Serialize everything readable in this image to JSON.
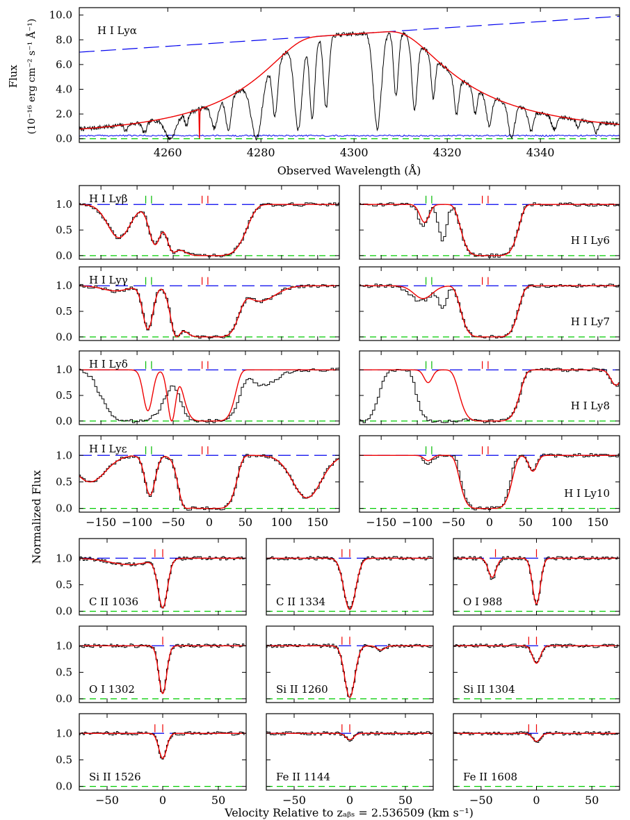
{
  "colors": {
    "data": "#000000",
    "model": "#ee0000",
    "continuum": "#0000ee",
    "error": "#0000ee",
    "zero": "#00cc00",
    "mark_green": "#00bb00",
    "mark_red": "#ee0000"
  },
  "labels": {
    "top_ylabel_1": "Flux",
    "top_ylabel_2": "(10⁻¹⁶ erg cm⁻² s⁻¹ Å⁻¹)",
    "top_xlabel": "Observed Wavelength (Å)",
    "norm_ylabel": "Normalized Flux",
    "bottom_xlabel": "Velocity Relative to zₐᵦₛ = 2.536509 (km s⁻¹)"
  },
  "chart_data": [
    {
      "type": "line",
      "id": "lya",
      "title": "H I Lyα",
      "xlabel": "Observed Wavelength (Å)",
      "ylabel": "Flux (10⁻¹⁶ erg cm⁻² s⁻¹ Å⁻¹)",
      "xlim": [
        4241,
        4357
      ],
      "ylim": [
        -0.3,
        10.6
      ],
      "xticks": [
        4260,
        4280,
        4300,
        4320,
        4340
      ],
      "yticks": [
        0.0,
        2.0,
        4.0,
        6.0,
        8.0,
        10.0
      ],
      "ytick_labels": [
        "0.0",
        "2.0",
        "4.0",
        "6.0",
        "8.0",
        "10.0"
      ],
      "continuum": {
        "x": [
          4241,
          4357
        ],
        "y": [
          7.0,
          9.9
        ]
      },
      "model": {
        "center": 4299.7,
        "width": 9.5,
        "metal_line": 4266.8
      },
      "absorbers": [
        [
          4251,
          0.45,
          0.5
        ],
        [
          4255,
          0.65,
          0.7
        ],
        [
          4260.5,
          1.0,
          1.6
        ],
        [
          4264,
          0.5,
          0.5
        ],
        [
          4270,
          0.7,
          1.0
        ],
        [
          4273,
          0.8,
          0.8
        ],
        [
          4279,
          1.0,
          1.6
        ],
        [
          4283,
          0.7,
          0.8
        ],
        [
          4288,
          0.9,
          1.2
        ],
        [
          4291,
          0.8,
          0.8
        ],
        [
          4294,
          0.7,
          0.8
        ],
        [
          4305,
          0.9,
          1.2
        ],
        [
          4309,
          0.6,
          0.7
        ],
        [
          4313,
          0.7,
          0.8
        ],
        [
          4317,
          0.5,
          0.6
        ],
        [
          4322,
          0.6,
          0.7
        ],
        [
          4326,
          0.5,
          0.6
        ],
        [
          4329,
          0.7,
          0.8
        ],
        [
          4333.8,
          1.0,
          0.9
        ],
        [
          4338,
          0.7,
          0.8
        ],
        [
          4343,
          0.6,
          0.8
        ],
        [
          4348,
          0.4,
          0.5
        ],
        [
          4352,
          0.6,
          0.6
        ]
      ],
      "series": [
        {
          "name": "data"
        },
        {
          "name": "model"
        },
        {
          "name": "continuum"
        },
        {
          "name": "error"
        }
      ]
    },
    {
      "type": "line",
      "id": "lyb",
      "label": "H I Lyβ",
      "label_pos": "top-left",
      "xlim": [
        -180,
        180
      ],
      "ylim": [
        -0.07,
        1.37
      ],
      "yticks": [
        0.0,
        0.5,
        1.0
      ],
      "ytick_labels": [
        "0.0",
        "0.5",
        "1.0"
      ],
      "xticks": [
        -150,
        -100,
        -50,
        0,
        50,
        100,
        150
      ],
      "green_marks": [
        -88,
        -80
      ],
      "red_marks": [
        -10,
        -2
      ],
      "components": [
        [
          -125,
          0.65,
          22
        ],
        [
          -75,
          0.78,
          12
        ],
        [
          -50,
          0.85,
          12
        ],
        [
          0,
          1.0,
          55,
          5
        ]
      ],
      "model_components": [
        [
          -125,
          0.65,
          22
        ],
        [
          -75,
          0.78,
          12
        ],
        [
          -50,
          0.85,
          12
        ],
        [
          0,
          1.0,
          55,
          5
        ]
      ],
      "extra_model_drop": {
        "from": 45,
        "to": 175
      }
    },
    {
      "type": "line",
      "id": "ly6",
      "label": "H I Ly6",
      "label_pos": "bottom-right",
      "xlim": [
        -180,
        180
      ],
      "ylim": [
        -0.07,
        1.37
      ],
      "yticks": [
        0.0,
        0.5,
        1.0
      ],
      "ytick_labels": [
        "0.0",
        "0.5",
        "1.0"
      ],
      "xticks": [
        -150,
        -100,
        -50,
        0,
        50,
        100,
        150
      ],
      "green_marks": [
        -88,
        -80
      ],
      "red_marks": [
        -10,
        -2
      ],
      "components": [
        [
          -92,
          0.4,
          9
        ],
        [
          0,
          1.0,
          42,
          6
        ],
        [
          -65,
          0.7,
          8
        ]
      ],
      "model_components": [
        [
          -90,
          0.35,
          9
        ],
        [
          0,
          1.0,
          42,
          6
        ]
      ]
    },
    {
      "type": "line",
      "id": "lyg",
      "label": "H I Lyγ",
      "label_pos": "top-left",
      "xlim": [
        -180,
        180
      ],
      "ylim": [
        -0.07,
        1.37
      ],
      "yticks": [
        0.0,
        0.5,
        1.0
      ],
      "ytick_labels": [
        "0.0",
        "0.5",
        "1.0"
      ],
      "xticks": [
        -150,
        -100,
        -50,
        0,
        50,
        100,
        150
      ],
      "green_marks": [
        -88,
        -80
      ],
      "red_marks": [
        -10,
        -2
      ],
      "components": [
        [
          -130,
          0.1,
          25
        ],
        [
          -85,
          0.85,
          10
        ],
        [
          -45,
          1.0,
          12
        ],
        [
          0,
          1.0,
          44,
          6
        ],
        [
          70,
          0.3,
          30
        ]
      ],
      "model_components": [
        [
          -130,
          0.1,
          25
        ],
        [
          -85,
          0.85,
          10
        ],
        [
          -45,
          1.0,
          12
        ],
        [
          0,
          1.0,
          44,
          6
        ],
        [
          70,
          0.3,
          30
        ]
      ]
    },
    {
      "type": "line",
      "id": "ly7",
      "label": "H I Ly7",
      "label_pos": "bottom-right",
      "xlim": [
        -180,
        180
      ],
      "ylim": [
        -0.07,
        1.37
      ],
      "yticks": [
        0.0,
        0.5,
        1.0
      ],
      "ytick_labels": [
        "0.0",
        "0.5",
        "1.0"
      ],
      "xticks": [
        -150,
        -100,
        -50,
        0,
        50,
        100,
        150
      ],
      "green_marks": [
        -88,
        -80
      ],
      "red_marks": [
        -10,
        -2
      ],
      "components": [
        [
          -95,
          0.3,
          20
        ],
        [
          0,
          1.0,
          42,
          6
        ],
        [
          -65,
          0.4,
          8
        ]
      ],
      "model_components": [
        [
          -92,
          0.25,
          18
        ],
        [
          0,
          1.0,
          42,
          6
        ]
      ]
    },
    {
      "type": "line",
      "id": "lyd",
      "label": "H I Lyδ",
      "label_pos": "top-left",
      "xlim": [
        -180,
        180
      ],
      "ylim": [
        -0.07,
        1.37
      ],
      "yticks": [
        0.0,
        0.5,
        1.0
      ],
      "ytick_labels": [
        "0.0",
        "0.5",
        "1.0"
      ],
      "xticks": [
        -150,
        -100,
        -50,
        0,
        50,
        100,
        150
      ],
      "green_marks": [
        -88,
        -80
      ],
      "red_marks": [
        -10,
        -2
      ],
      "components": [
        [
          -105,
          1.0,
          50,
          4
        ],
        [
          0,
          1.0,
          44,
          6
        ],
        [
          75,
          0.3,
          25
        ]
      ],
      "model_components": [
        [
          -85,
          0.8,
          9
        ],
        [
          0,
          1.0,
          38,
          6
        ],
        [
          -52,
          1.0,
          8
        ]
      ]
    },
    {
      "type": "line",
      "id": "ly8",
      "label": "H I Ly8",
      "label_pos": "bottom-right",
      "xlim": [
        -180,
        180
      ],
      "ylim": [
        -0.07,
        1.37
      ],
      "yticks": [
        0.0,
        0.5,
        1.0
      ],
      "ytick_labels": [
        "0.0",
        "0.5",
        "1.0"
      ],
      "xticks": [
        -150,
        -100,
        -50,
        0,
        50,
        100,
        150
      ],
      "green_marks": [
        -88,
        -80
      ],
      "red_marks": [
        -10,
        -2
      ],
      "components": [
        [
          -175,
          1.0,
          25,
          3
        ],
        [
          -65,
          1.0,
          38,
          6
        ],
        [
          0,
          1.0,
          44,
          6
        ],
        [
          175,
          0.3,
          10
        ]
      ],
      "model_components": [
        [
          -85,
          0.25,
          8
        ],
        [
          0,
          1.0,
          44,
          6
        ],
        [
          175,
          0.3,
          10
        ]
      ]
    },
    {
      "type": "line",
      "id": "lye",
      "label": "H I Lyε",
      "label_pos": "top-left",
      "xlim": [
        -180,
        180
      ],
      "ylim": [
        -0.07,
        1.37
      ],
      "yticks": [
        0.0,
        0.5,
        1.0
      ],
      "ytick_labels": [
        "0.0",
        "0.5",
        "1.0"
      ],
      "xticks": [
        -150,
        -100,
        -50,
        0,
        50,
        100,
        150
      ],
      "green_marks": [
        -88,
        -80
      ],
      "red_marks": [
        -10,
        -2
      ],
      "components": [
        [
          -165,
          0.5,
          30
        ],
        [
          -82,
          0.75,
          10
        ],
        [
          -30,
          1.0,
          15
        ],
        [
          0,
          1.0,
          40,
          6
        ],
        [
          135,
          0.8,
          28
        ]
      ],
      "model_components": [
        [
          -165,
          0.5,
          30
        ],
        [
          -82,
          0.75,
          10
        ],
        [
          -30,
          1.0,
          15
        ],
        [
          0,
          1.0,
          40,
          6
        ],
        [
          135,
          0.8,
          28
        ]
      ]
    },
    {
      "type": "line",
      "id": "ly10",
      "label": "H I Ly10",
      "label_pos": "bottom-right",
      "xlim": [
        -180,
        180
      ],
      "ylim": [
        -0.07,
        1.37
      ],
      "yticks": [
        0.0,
        0.5,
        1.0
      ],
      "ytick_labels": [
        "0.0",
        "0.5",
        "1.0"
      ],
      "xticks": [
        -150,
        -100,
        -50,
        0,
        50,
        100,
        150
      ],
      "green_marks": [
        -88,
        -80
      ],
      "red_marks": [
        -10,
        -2
      ],
      "data_xmin": -95,
      "components": [
        [
          -85,
          0.15,
          8
        ],
        [
          -5,
          1.0,
          36,
          6
        ],
        [
          60,
          0.3,
          8
        ]
      ],
      "model_components": [
        [
          -85,
          0.1,
          8
        ],
        [
          -5,
          1.0,
          38,
          6
        ],
        [
          60,
          0.3,
          8
        ]
      ]
    },
    {
      "type": "line",
      "id": "c2_1036",
      "label": "C II 1036",
      "label_pos": "bottom-left",
      "xlim": [
        -75,
        75
      ],
      "ylim": [
        -0.07,
        1.37
      ],
      "yticks": [
        0.0,
        0.5,
        1.0
      ],
      "ytick_labels": [
        "0.0",
        "0.5",
        "1.0"
      ],
      "xticks": [
        -50,
        0,
        50
      ],
      "red_marks": [
        -7,
        0
      ],
      "components": [
        [
          -30,
          0.12,
          25
        ],
        [
          0,
          0.93,
          6
        ]
      ],
      "model_components": [
        [
          -30,
          0.12,
          25
        ],
        [
          0,
          0.93,
          6
        ]
      ]
    },
    {
      "type": "line",
      "id": "c2_1334",
      "label": "C II 1334",
      "label_pos": "bottom-left",
      "xlim": [
        -75,
        75
      ],
      "ylim": [
        -0.07,
        1.37
      ],
      "yticks": [
        0.0,
        0.5,
        1.0
      ],
      "ytick_labels": [
        "0.0",
        "0.5",
        "1.0"
      ],
      "xticks": [
        -50,
        0,
        50
      ],
      "red_marks": [
        -7,
        0
      ],
      "components": [
        [
          0,
          0.97,
          7.5
        ]
      ],
      "model_components": [
        [
          0,
          0.97,
          7.5
        ]
      ]
    },
    {
      "type": "line",
      "id": "o1_988",
      "label": "O I 988",
      "label_pos": "bottom-left",
      "xlim": [
        -75,
        75
      ],
      "ylim": [
        -0.07,
        1.37
      ],
      "yticks": [
        0.0,
        0.5,
        1.0
      ],
      "ytick_labels": [
        "0.0",
        "0.5",
        "1.0"
      ],
      "xticks": [
        -50,
        0,
        50
      ],
      "red_marks": [
        -37,
        0
      ],
      "components": [
        [
          -40,
          0.38,
          5
        ],
        [
          0,
          0.88,
          5
        ]
      ],
      "model_components": [
        [
          -40,
          0.36,
          5
        ],
        [
          0,
          0.86,
          5
        ]
      ]
    },
    {
      "type": "line",
      "id": "o1_1302",
      "label": "O I 1302",
      "label_pos": "bottom-left",
      "xlim": [
        -75,
        75
      ],
      "ylim": [
        -0.07,
        1.37
      ],
      "yticks": [
        0.0,
        0.5,
        1.0
      ],
      "ytick_labels": [
        "0.0",
        "0.5",
        "1.0"
      ],
      "xticks": [
        -50,
        0,
        50
      ],
      "red_marks": [
        0
      ],
      "components": [
        [
          0,
          0.9,
          5
        ]
      ],
      "model_components": [
        [
          0,
          0.9,
          5
        ]
      ]
    },
    {
      "type": "line",
      "id": "si2_1260",
      "label": "Si II 1260",
      "label_pos": "bottom-left",
      "xlim": [
        -75,
        75
      ],
      "ylim": [
        -0.07,
        1.37
      ],
      "yticks": [
        0.0,
        0.5,
        1.0
      ],
      "ytick_labels": [
        "0.0",
        "0.5",
        "1.0"
      ],
      "xticks": [
        -50,
        0,
        50
      ],
      "red_marks": [
        -7,
        0
      ],
      "components": [
        [
          0,
          0.97,
          6.5
        ],
        [
          28,
          0.08,
          5
        ]
      ],
      "model_components": [
        [
          0,
          0.97,
          6.5
        ],
        [
          28,
          0.08,
          5
        ]
      ]
    },
    {
      "type": "line",
      "id": "si2_1304",
      "label": "Si II 1304",
      "label_pos": "bottom-left",
      "xlim": [
        -75,
        75
      ],
      "ylim": [
        -0.07,
        1.37
      ],
      "yticks": [
        0.0,
        0.5,
        1.0
      ],
      "ytick_labels": [
        "0.0",
        "0.5",
        "1.0"
      ],
      "xticks": [
        -50,
        0,
        50
      ],
      "red_marks": [
        -7,
        0
      ],
      "components": [
        [
          0,
          0.33,
          5
        ]
      ],
      "model_components": [
        [
          0,
          0.33,
          5
        ]
      ]
    },
    {
      "type": "line",
      "id": "si2_1526",
      "label": "Si II 1526",
      "label_pos": "bottom-left",
      "xlim": [
        -75,
        75
      ],
      "ylim": [
        -0.07,
        1.37
      ],
      "yticks": [
        0.0,
        0.5,
        1.0
      ],
      "ytick_labels": [
        "0.0",
        "0.5",
        "1.0"
      ],
      "xticks": [
        -50,
        0,
        50
      ],
      "red_marks": [
        -7,
        0
      ],
      "components": [
        [
          0,
          0.47,
          5
        ]
      ],
      "model_components": [
        [
          0,
          0.47,
          5
        ]
      ]
    },
    {
      "type": "line",
      "id": "fe2_1144",
      "label": "Fe II 1144",
      "label_pos": "bottom-left",
      "xlim": [
        -75,
        75
      ],
      "ylim": [
        -0.07,
        1.37
      ],
      "yticks": [
        0.0,
        0.5,
        1.0
      ],
      "ytick_labels": [
        "0.0",
        "0.5",
        "1.0"
      ],
      "xticks": [
        -50,
        0,
        50
      ],
      "red_marks": [
        -7,
        0
      ],
      "components": [
        [
          0,
          0.12,
          5
        ]
      ],
      "model_components": [
        [
          0,
          0.12,
          5
        ]
      ]
    },
    {
      "type": "line",
      "id": "fe2_1608",
      "label": "Fe II 1608",
      "label_pos": "bottom-left",
      "xlim": [
        -75,
        75
      ],
      "ylim": [
        -0.07,
        1.37
      ],
      "yticks": [
        0.0,
        0.5,
        1.0
      ],
      "ytick_labels": [
        "0.0",
        "0.5",
        "1.0"
      ],
      "xticks": [
        -50,
        0,
        50
      ],
      "red_marks": [
        -7,
        0
      ],
      "components": [
        [
          0,
          0.15,
          5
        ]
      ],
      "model_components": [
        [
          0,
          0.15,
          5
        ]
      ]
    }
  ]
}
